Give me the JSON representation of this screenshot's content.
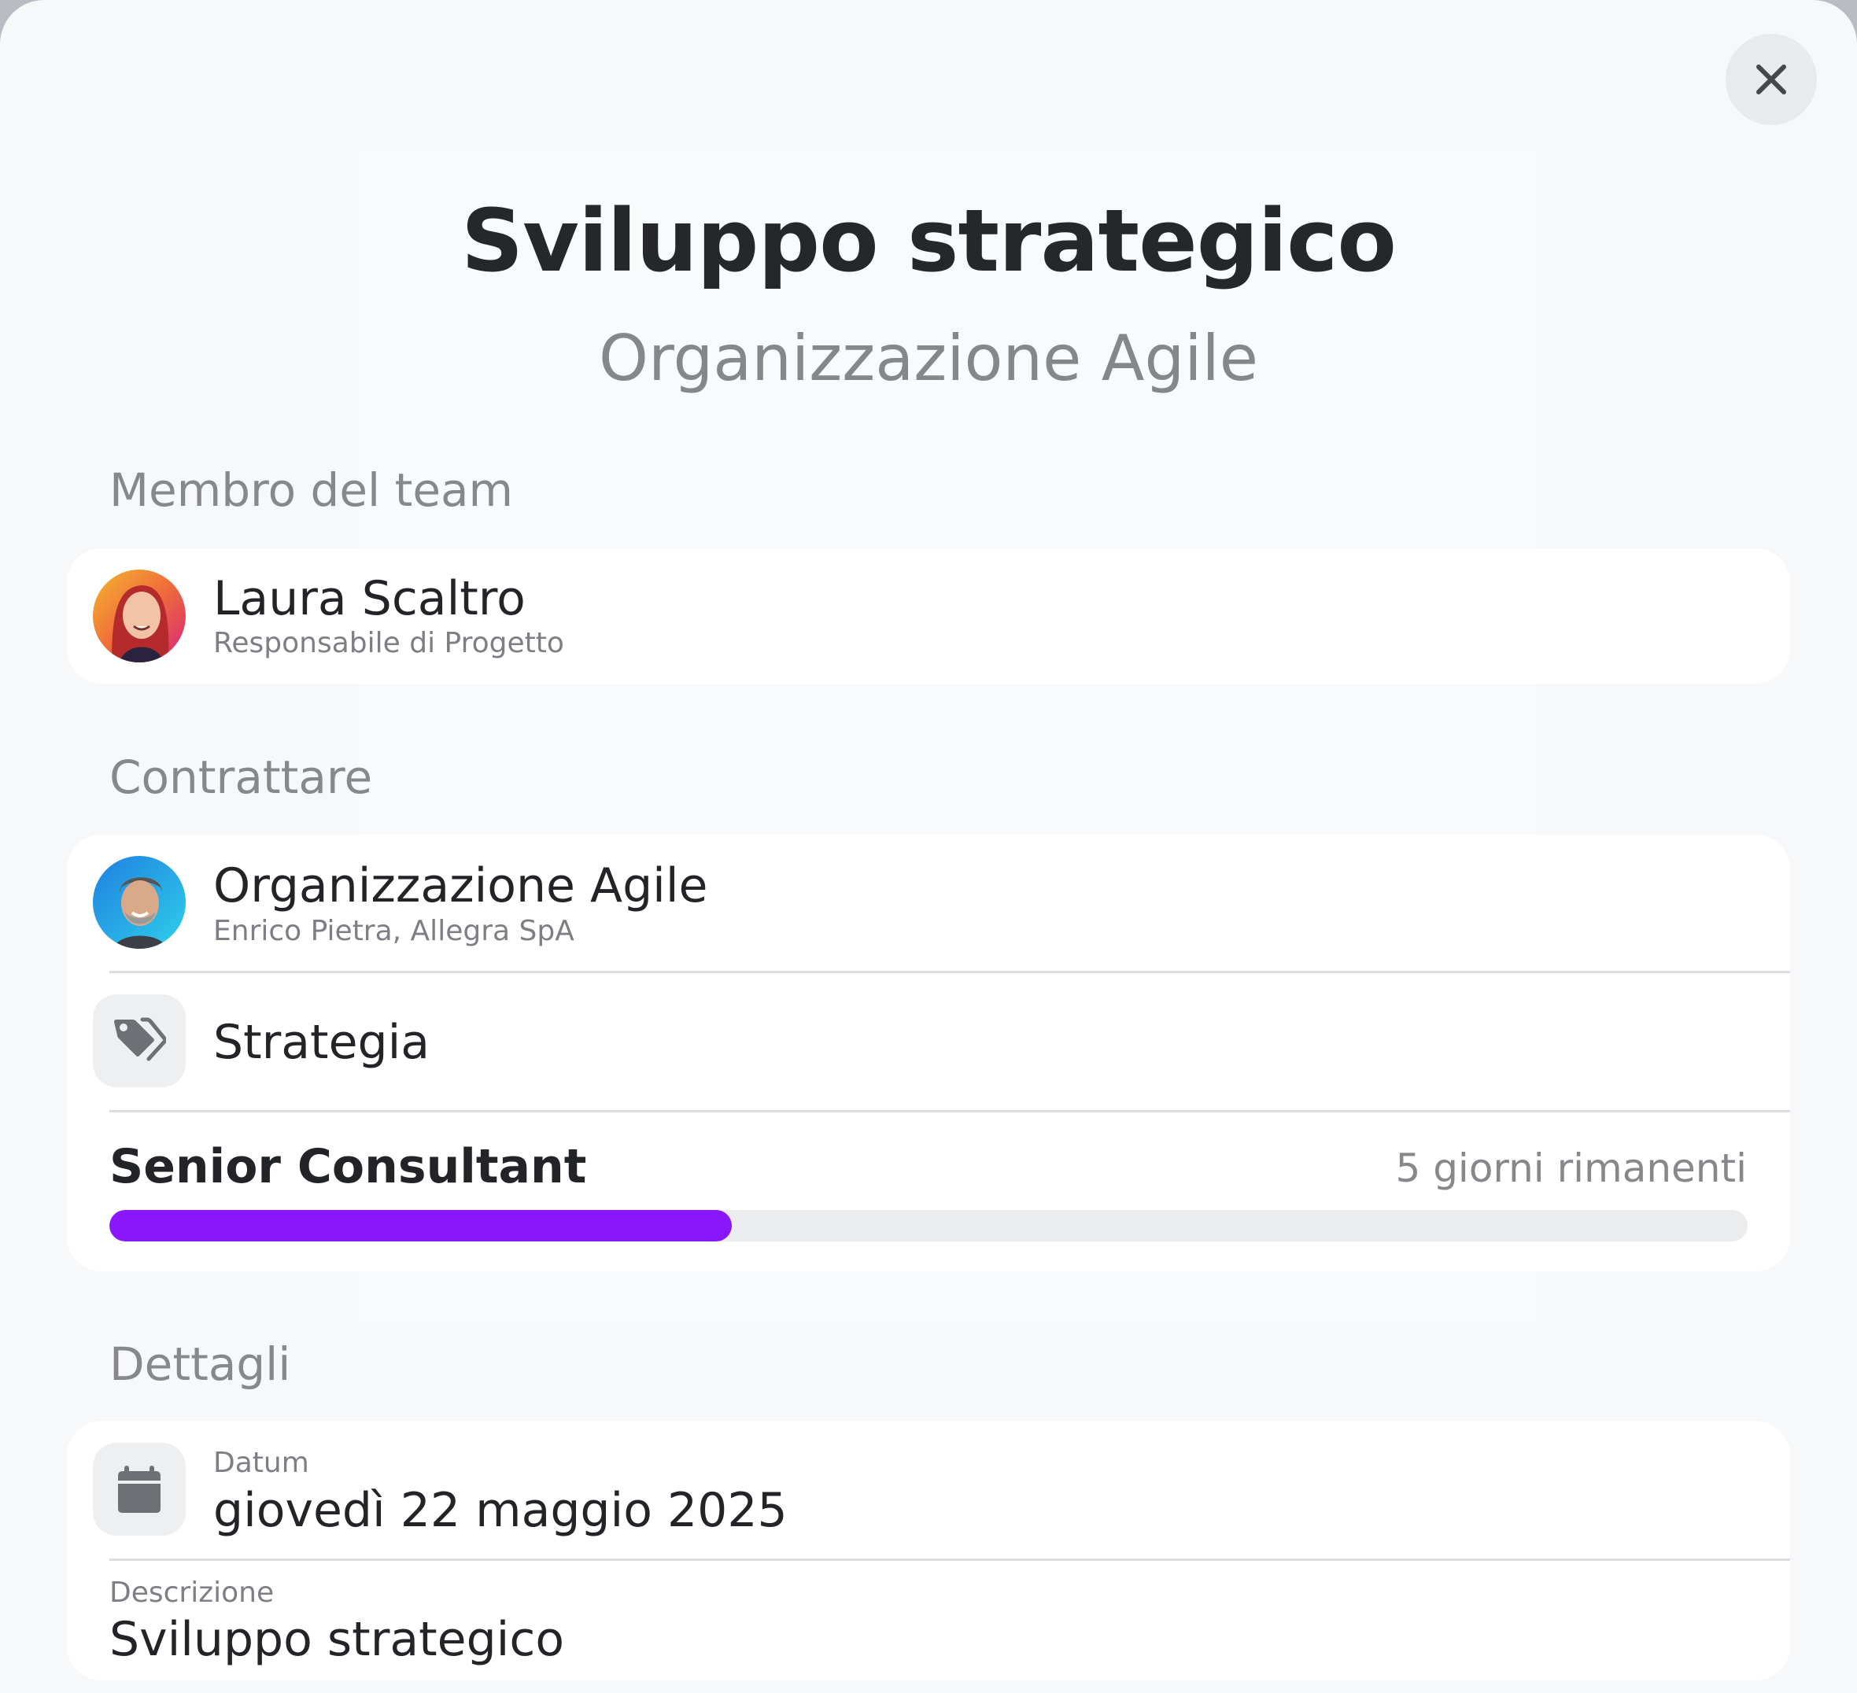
{
  "modal": {
    "title": "Sviluppo strategico",
    "subtitle": "Organizzazione Agile",
    "close_icon": "close-icon"
  },
  "team": {
    "section_label": "Membro del team",
    "member": {
      "name": "Laura Scaltro",
      "role": "Responsabile di Progetto",
      "avatar": "avatar-photo-woman"
    }
  },
  "contract": {
    "section_label": "Contrattare",
    "client": {
      "name": "Organizzazione Agile",
      "contact": "Enrico Pietra, Allegra SpA",
      "avatar": "avatar-photo-man"
    },
    "category": {
      "label": "Strategia",
      "icon": "tag-icon"
    },
    "role": {
      "label": "Senior Consultant",
      "remaining": "5 giorni rimanenti",
      "progress_fraction": 0.38,
      "progress_color": "#8a16fa"
    }
  },
  "details": {
    "section_label": "Dettagli",
    "date": {
      "caption": "Datum",
      "value": "giovedì 22 maggio 2025",
      "icon": "calendar-icon"
    },
    "description": {
      "caption": "Descrizione",
      "value": "Sviluppo strategico"
    }
  }
}
